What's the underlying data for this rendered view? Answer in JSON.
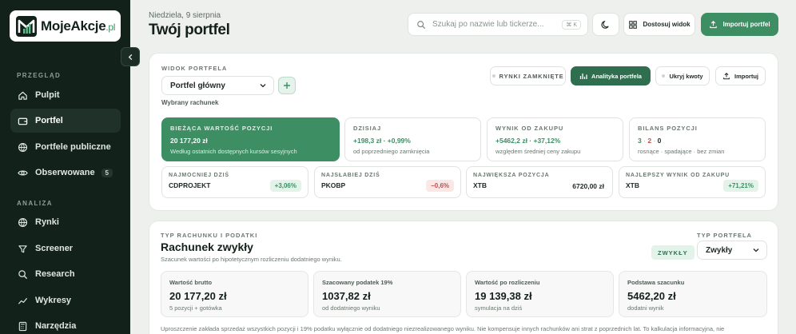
{
  "app": {
    "logo_main": "MojeAkcje",
    "logo_suffix": ".pl"
  },
  "sidebar": {
    "sections": [
      {
        "label": "PRZEGLĄD"
      },
      {
        "label": "ANALIZA"
      }
    ],
    "items": [
      {
        "label": "Pulpit",
        "icon": "home-icon"
      },
      {
        "label": "Portfel",
        "icon": "wallet-icon",
        "active": true
      },
      {
        "label": "Portfele publiczne",
        "icon": "globe-icon"
      },
      {
        "label": "Obserwowane",
        "icon": "eye-icon",
        "badge": "5"
      },
      {
        "label": "Rynki",
        "icon": "globe-icon"
      },
      {
        "label": "Screener",
        "icon": "filter-icon"
      },
      {
        "label": "Research",
        "icon": "search-icon"
      },
      {
        "label": "Wykresy",
        "icon": "chart-icon"
      },
      {
        "label": "Narzędzia",
        "icon": "calculator-icon"
      }
    ]
  },
  "header": {
    "date": "Niedziela, 9 sierpnia",
    "title": "Twój portfel",
    "search_placeholder": "Szukaj po nazwie lub tickerze...",
    "search_shortcut": "⌘ K",
    "customize_label": "Dostosuj widok",
    "import_label": "Importuj portfel"
  },
  "portfolio": {
    "view_label": "WIDOK PORTFELA",
    "selected_portfolio": "Portfel główny",
    "selected_account_label": "Wybrany rachunek",
    "market_status": "RYNKI ZAMKNIĘTE",
    "analytics_label": "Analityka portfela",
    "hide_amounts_label": "Ukryj kwoty",
    "import_label": "Importuj",
    "cards": [
      {
        "label": "BIEŻĄCA WARTOŚĆ POZYCJI",
        "value": "20 177,20 zł",
        "sub": "Według ostatnich dostępnych kursów sesyjnych"
      },
      {
        "label": "DZISIAJ",
        "value": "+198,3 zł · +0,99%",
        "sub": "od poprzedniego zamknięcia"
      },
      {
        "label": "WYNIK OD ZAKUPU",
        "value": "+5462,2 zł · +37,12%",
        "sub": "względem średniej ceny zakupu"
      },
      {
        "label": "BILANS POZYCJI",
        "value_up": "3",
        "value_down": "2",
        "value_flat": "0",
        "sep": "·",
        "sub": "rosnące · spadające · bez zmian"
      }
    ],
    "movers": [
      {
        "label": "NAJMOCNIEJ DZIŚ",
        "ticker": "CDPROJEKT",
        "value": "+3,06%",
        "tone": "green"
      },
      {
        "label": "NAJSŁABIEJ DZIŚ",
        "ticker": "PKOBP",
        "value": "−0,6%",
        "tone": "red"
      },
      {
        "label": "NAJWIĘKSZA POZYCJA",
        "ticker": "XTB",
        "value": "6720,00 zł",
        "tone": "plain"
      },
      {
        "label": "NAJLEPSZY WYNIK OD ZAKUPU",
        "ticker": "XTB",
        "value": "+71,21%",
        "tone": "green"
      }
    ]
  },
  "account": {
    "section_label": "TYP RACHUNKU I PODATKI",
    "title": "Rachunek zwykły",
    "description": "Szacunek wartości po hipotetycznym rozliczeniu dodatniego wyniku.",
    "badge": "ZWYKŁY",
    "type_label": "TYP PORTFELA",
    "type_value": "Zwykły",
    "cards": [
      {
        "label": "Wartość brutto",
        "value": "20 177,20 zł",
        "sub": "5 pozycji + gotówka"
      },
      {
        "label": "Szacowany podatek 19%",
        "value": "1037,82 zł",
        "sub": "od dodatniego wyniku"
      },
      {
        "label": "Wartość po rozliczeniu",
        "value": "19 139,38 zł",
        "sub": "symulacja na dziś"
      },
      {
        "label": "Podstawa szacunku",
        "value": "5462,20 zł",
        "sub": "dodatni wynik"
      }
    ],
    "footnote": "Uproszczenie zakłada sprzedaż wszystkich pozycji i 19% podatku wyłącznie od dodatniego niezrealizowanego wyniku. Nie kompensuje innych rachunków ani strat z poprzednich lat. To kalkulacja informacyjna, nie"
  },
  "colors": {
    "accent": "#3e8e64",
    "sidebar_bg": "#13211b",
    "negative": "#c0504d"
  }
}
